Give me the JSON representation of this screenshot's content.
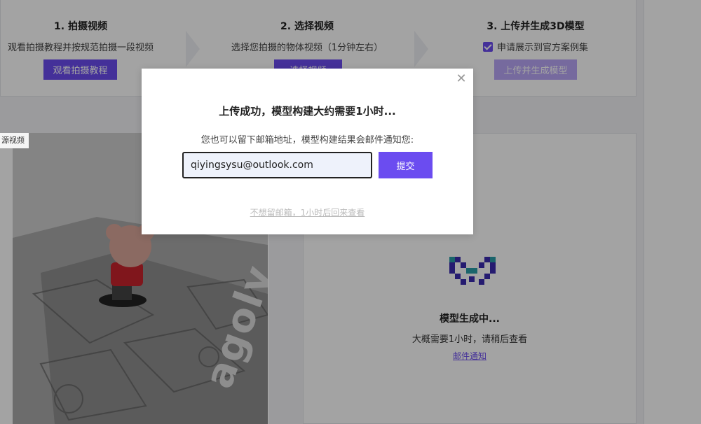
{
  "steps": [
    {
      "title": "1. 拍摄视频",
      "desc": "观看拍摄教程并按规范拍摄一段视频",
      "button": "观看拍摄教程"
    },
    {
      "title": "2. 选择视频",
      "desc": "选择您拍摄的物体视频（1分钟左右）",
      "button": "选择视频"
    },
    {
      "title": "3. 上传并生成3D模型",
      "consent_label": "申请展示到官方案例集",
      "consent_checked": true,
      "button": "上传并生成模型"
    }
  ],
  "video": {
    "tag": "源视频",
    "photo_text": "agoly"
  },
  "model": {
    "title": "模型生成中...",
    "desc": "大概需要1小时，请稍后查看",
    "link": "邮件通知"
  },
  "modal": {
    "title": "上传成功，模型构建大约需要1小时...",
    "desc": "您也可以留下邮箱地址，模型构建结果会邮件通知您:",
    "email_value": "qiyingsysu@outlook.com",
    "submit": "提交",
    "skip": "不想留邮箱，1小时后回来查看",
    "close_icon": "close-icon"
  },
  "colors": {
    "accent": "#6b4cf0",
    "accent_disabled": "#b9a6f7",
    "overlay": "rgba(0,0,0,0.36)"
  }
}
